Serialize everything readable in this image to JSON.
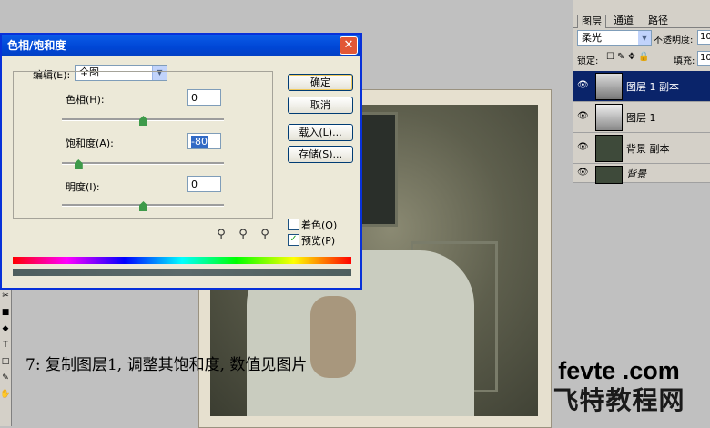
{
  "dialog": {
    "title": "色相/饱和度",
    "edit_label": "编辑(E):",
    "edit_value": "全图",
    "hue_label": "色相(H):",
    "hue_value": "0",
    "saturation_label": "饱和度(A):",
    "saturation_value": "-80",
    "lightness_label": "明度(I):",
    "lightness_value": "0",
    "ok_label": "确定",
    "cancel_label": "取消",
    "load_label": "载入(L)...",
    "save_label": "存储(S)...",
    "colorize_label": "着色(O)",
    "colorize_checked": false,
    "preview_label": "预览(P)",
    "preview_checked": true,
    "hue_slider": 0,
    "saturation_slider": -80,
    "lightness_slider": 0
  },
  "panel": {
    "tabs": [
      "图层",
      "通道",
      "路径"
    ],
    "blend_mode": "柔光",
    "opacity_label": "不透明度:",
    "opacity_value": "10",
    "lock_label": "锁定:",
    "fill_label": "填充:",
    "fill_value": "10",
    "layers": [
      {
        "name": "图层 1 副本",
        "selected": true
      },
      {
        "name": "图层 1",
        "selected": false
      },
      {
        "name": "背景 副本",
        "selected": false
      },
      {
        "name": "背景",
        "selected": false
      }
    ]
  },
  "caption": "7: 复制图层1, 调整其饱和度, 数值见图片",
  "logo": {
    "line1": "fevte .com",
    "line2": "飞特教程网"
  },
  "icons": {
    "eye": "eye-icon",
    "close": "close-icon",
    "eyedropper": "eyedropper-icon"
  }
}
